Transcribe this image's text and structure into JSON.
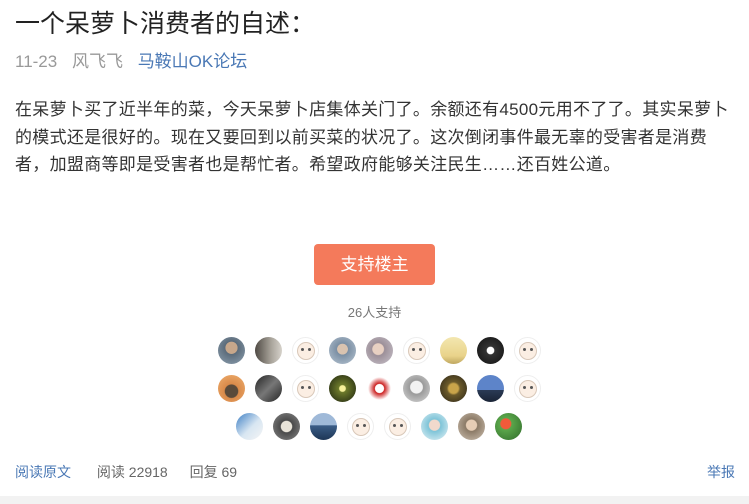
{
  "post": {
    "title": "一个呆萝卜消费者的自述：",
    "date": "11-23",
    "author": "风飞飞",
    "source": "马鞍山OK论坛",
    "body": "在呆萝卜买了近半年的菜，今天呆萝卜店集体关门了。余额还有4500元用不了了。其实呆萝卜的模式还是很好的。现在又要回到以前买菜的状况了。这次倒闭事件最无辜的受害者是消费者，加盟商等即是受害者也是帮忙者。希望政府能够关注民生……还百姓公道。"
  },
  "support": {
    "button_label": "支持楼主",
    "count_text": "26人支持"
  },
  "footer": {
    "read_original": "阅读原文",
    "reads": "阅读 22918",
    "replies": "回复 69",
    "report": "举报"
  },
  "colors": {
    "accent": "#f47a5b",
    "link": "#4a78b5"
  }
}
